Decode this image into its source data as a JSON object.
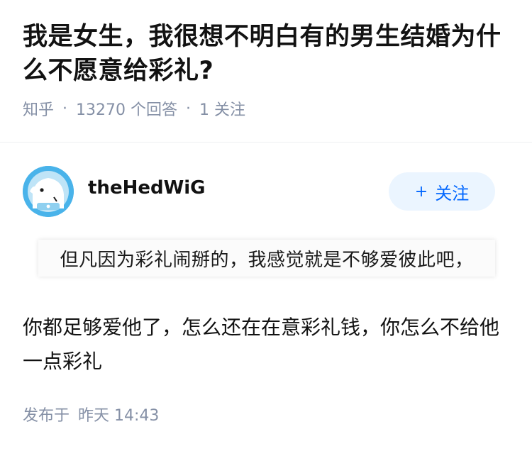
{
  "question": {
    "title": "我是女生，我很想不明白有的男生结婚为什么不愿意给彩礼?",
    "source": "知乎",
    "answer_count": "13270 个回答",
    "follow_count": "1 关注"
  },
  "author": {
    "name": "theHedWiG",
    "follow_label": "关注",
    "follow_icon": "plus-icon"
  },
  "answer": {
    "quote_image_text": "但凡因为彩礼闹掰的，我感觉就是不够爱彼此吧，",
    "body": "你都足够爱他了，怎么还在在意彩礼钱，你怎么不给他一点彩礼",
    "published_label": "发布于",
    "published_time": "昨天 14:43"
  }
}
